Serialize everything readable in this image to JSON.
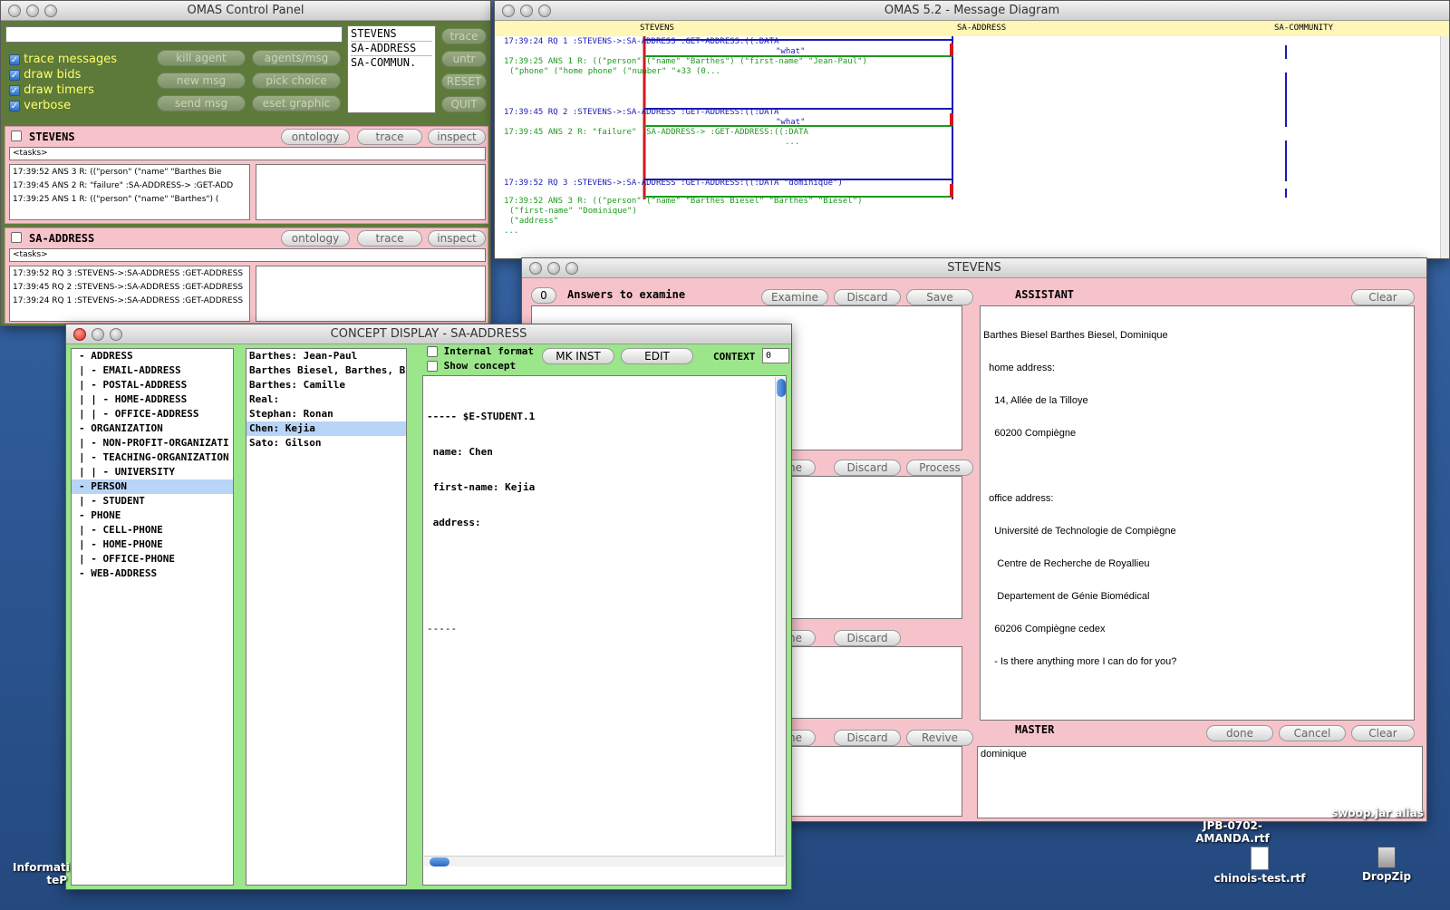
{
  "control_panel": {
    "title": "OMAS Control Panel",
    "checkboxes": [
      "trace messages",
      "draw bids",
      "draw timers",
      "verbose"
    ],
    "buttons": [
      "kill agent",
      "agents/msg",
      "new msg",
      "pick choice",
      "send msg",
      "eset graphic"
    ],
    "agent_list": [
      "STEVENS",
      "SA-ADDRESS",
      "SA-COMMUN."
    ],
    "side_buttons": [
      "trace",
      "untr",
      "RESET",
      "QUIT"
    ]
  },
  "stevens_panel": {
    "name": "STEVENS",
    "buttons": [
      "ontology",
      "trace",
      "inspect"
    ],
    "tasks": "<tasks>",
    "log": [
      "17:39:52 ANS 3 R: ((\"person\" (\"name\" \"Barthes Bie",
      "17:39:45 ANS 2 R: \"failure\" :SA-ADDRESS-> :GET-ADD",
      "17:39:25 ANS 1 R: ((\"person\" (\"name\" \"Barthes\") ("
    ]
  },
  "sa_address_panel": {
    "name": "SA-ADDRESS",
    "buttons": [
      "ontology",
      "trace",
      "inspect"
    ],
    "tasks": "<tasks>",
    "log": [
      "17:39:52 RQ 3 :STEVENS->:SA-ADDRESS :GET-ADDRESS",
      "17:39:45 RQ 2 :STEVENS->:SA-ADDRESS :GET-ADDRESS",
      "17:39:24 RQ 1 :STEVENS->:SA-ADDRESS :GET-ADDRESS"
    ]
  },
  "message_diagram": {
    "title": "OMAS 5.2 - Message Diagram",
    "columns": [
      "STEVENS",
      "SA-ADDRESS",
      "SA-COMMUNITY"
    ],
    "lines": [
      {
        "text": "17:39:24 RQ 1 :STEVENS->:SA-ADDRESS :GET-ADDRESS:((:DATA",
        "color": "#1a1ab4"
      },
      {
        "text": "\"what\"",
        "color": "#1a1ab4"
      },
      {
        "text": "17:39:25 ANS 1 R: ((\"person\" (\"name\" \"Barthes\") (\"first-name\" \"Jean-Paul\")",
        "color": "#1c9a1c"
      },
      {
        "text": "(\"phone\" (\"home phone\" (\"number\" \"+33 (0...",
        "color": "#1c9a1c"
      },
      {
        "text": "17:39:45 RQ 2 :STEVENS->:SA-ADDRESS :GET-ADDRESS:((:DATA",
        "color": "#1a1ab4"
      },
      {
        "text": "\"what\"",
        "color": "#1a1ab4"
      },
      {
        "text": "17:39:45 ANS 2 R: \"failure\" :SA-ADDRESS-> :GET-ADDRESS:((:DATA",
        "color": "#1c9a1c"
      },
      {
        "text": "...",
        "color": "#1c9a1c"
      },
      {
        "text": "17:39:52 RQ 3 :STEVENS->:SA-ADDRESS :GET-ADDRESS:((:DATA \"dominique\")",
        "color": "#1a1ab4"
      },
      {
        "text": "17:39:52 ANS 3 R: ((\"person\" (\"name\" \"Barthes Biesel\" \"Barthes\" \"Biesel\")",
        "color": "#1c9a1c"
      },
      {
        "text": "(\"first-name\" \"Dominique\")",
        "color": "#1c9a1c"
      },
      {
        "text": "(\"address\"",
        "color": "#1c9a1c"
      },
      {
        "text": "...",
        "color": "#1c9a1c"
      }
    ]
  },
  "stevens_window": {
    "title": "STEVENS",
    "count": "0",
    "answers_label": "Answers to examine",
    "answers_buttons": [
      "Examine",
      "Discard",
      "Save"
    ],
    "row2_buttons": [
      "mine",
      "Discard",
      "Process"
    ],
    "row3_buttons": [
      "mine",
      "Discard"
    ],
    "row4_buttons": [
      "mine",
      "Discard",
      "Revive"
    ],
    "assistant_label": "ASSISTANT",
    "clear_label": "Clear",
    "assistant_text": [
      "Barthes Biesel Barthes Biesel, Dominique",
      "  home address:",
      "    14, Allée de la Tilloye",
      "    60200 Compiègne",
      "",
      "  office address:",
      "    Université de Technologie de Compiègne",
      "     Centre de Recherche de Royallieu",
      "     Departement de Génie Biomédical",
      "    60206 Compiègne cedex",
      "    - Is there anything more I can do for you?"
    ],
    "master_label": "MASTER",
    "master_buttons": [
      "done",
      "Cancel",
      "Clear"
    ],
    "master_input": "dominique"
  },
  "concept_display": {
    "title": "CONCEPT DISPLAY - SA-ADDRESS",
    "concepts": [
      "- ADDRESS",
      "| - EMAIL-ADDRESS",
      "| - POSTAL-ADDRESS",
      "| | - HOME-ADDRESS",
      "| | - OFFICE-ADDRESS",
      "- ORGANIZATION",
      "| - NON-PROFIT-ORGANIZATI",
      "| - TEACHING-ORGANIZATION",
      "| | - UNIVERSITY",
      "- PERSON",
      "| - STUDENT",
      "- PHONE",
      "| - CELL-PHONE",
      "| - HOME-PHONE",
      "| - OFFICE-PHONE",
      "- WEB-ADDRESS"
    ],
    "selected_concept": "- PERSON",
    "instances": [
      "Barthes: Jean-Paul",
      "Barthes Biesel, Barthes, Biesel:",
      "Barthes: Camille",
      "Real:",
      "Stephan: Ronan",
      "Chen: Kejia",
      "Sato: Gilson"
    ],
    "selected_instance": "Chen: Kejia",
    "internal_format": "Internal format",
    "show_concept": "Show concept",
    "mk_inst": "MK INST",
    "edit": "EDIT",
    "context_label": "CONTEXT",
    "context_value": "0",
    "detail": [
      "----- $E-STUDENT.1",
      " name: Chen",
      " first-name: Kejia",
      " address:",
      "",
      "",
      "-----"
    ]
  },
  "desktop_icons": [
    {
      "label": "JPB-0702-\nAMANDA.rtf"
    },
    {
      "label": "swoop.jar alias"
    },
    {
      "label": "chinois-test.rtf"
    },
    {
      "label": "DropZip"
    },
    {
      "label": "Informati\nteP"
    }
  ]
}
